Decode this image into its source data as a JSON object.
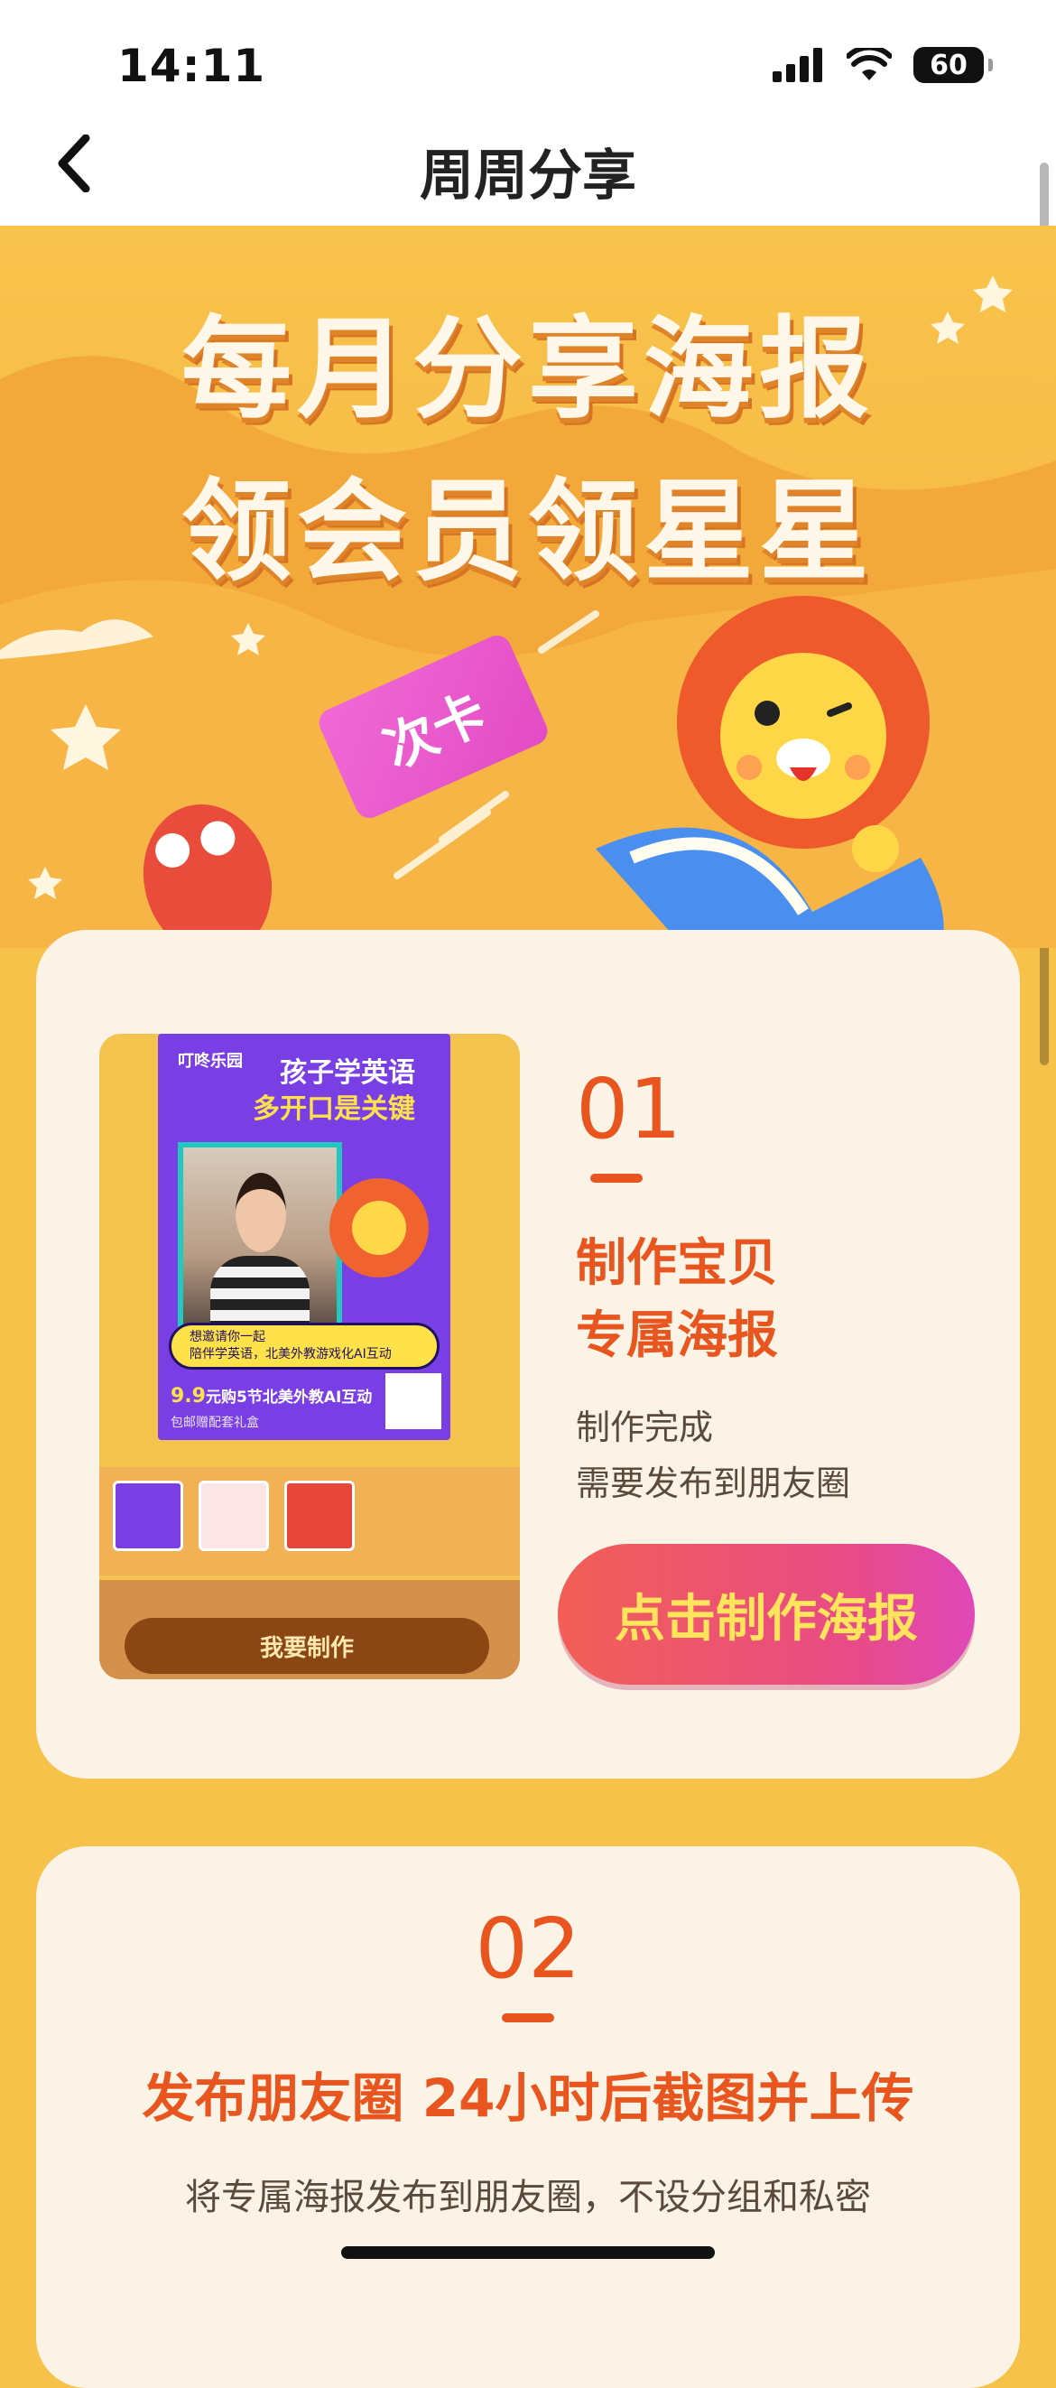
{
  "status_bar": {
    "time": "14:11",
    "battery": "60",
    "battery_level_percent": 60
  },
  "nav": {
    "title": "周周分享"
  },
  "hero": {
    "title_line1": "每月分享海报",
    "title_line2": "领会员领星星",
    "ticket_label": "次卡"
  },
  "step1": {
    "number": "01",
    "title_line1": "制作宝贝",
    "title_line2": "专属海报",
    "desc_line1": "制作完成",
    "desc_line2": "需要发布到朋友圈",
    "cta_label": "点击制作海报",
    "poster": {
      "brand": "叮咚乐园",
      "headline1": "孩子学英语",
      "headline2": "多开口是关键",
      "bubble_line1": "想邀请你一起",
      "bubble_line2": "陪伴学英语，北美外教游戏化AI互动",
      "price": "9.9",
      "price_text": "元购5节北美外教AI互动",
      "gift": "包邮赠配套礼盒",
      "make_button": "我要制作"
    }
  },
  "step2": {
    "number": "02",
    "title": "发布朋友圈 24小时后截图并上传",
    "desc": "将专属海报发布到朋友圈，不设分组和私密"
  },
  "colors": {
    "accent": "#e8551f",
    "background": "#f6c24a",
    "card": "#fbf4e6"
  }
}
